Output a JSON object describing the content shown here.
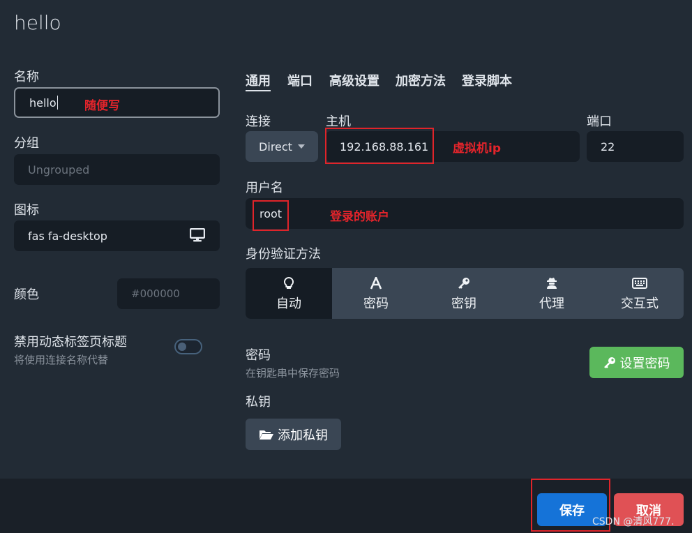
{
  "dialog": {
    "title": "hello"
  },
  "left": {
    "name_label": "名称",
    "name_value": "hello",
    "group_label": "分组",
    "group_placeholder": "Ungrouped",
    "icon_label": "图标",
    "icon_value": "fas fa-desktop",
    "color_label": "颜色",
    "color_placeholder": "#000000",
    "disable_title_label": "禁用动态标签页标题",
    "disable_title_sub": "将使用连接名称代替",
    "disable_title_on": false
  },
  "tabs": [
    "通用",
    "端口",
    "高级设置",
    "加密方法",
    "登录脚本"
  ],
  "connection": {
    "conn_label": "连接",
    "conn_value": "Direct",
    "host_label": "主机",
    "host_value": "192.168.88.161",
    "port_label": "端口",
    "port_value": "22",
    "user_label": "用户名",
    "user_value": "root",
    "auth_label": "身份验证方法",
    "auth_methods": [
      "自动",
      "密码",
      "密钥",
      "代理",
      "交互式"
    ],
    "auth_selected": "自动",
    "password_label": "密码",
    "password_sub": "在钥匙串中保存密码",
    "set_password_button": "设置密码",
    "private_key_label": "私钥",
    "add_key_button": "添加私钥"
  },
  "footer": {
    "save_button": "保存",
    "cancel_button": "取消",
    "watermark": "CSDN @清风777."
  },
  "annotations": {
    "name_note": "随便写",
    "host_note": "虚拟机ip",
    "user_note": "登录的账户"
  },
  "colors": {
    "background": "#222b35",
    "field": "#161d25",
    "save": "#1573d8",
    "cancel": "#e05155",
    "set_password": "#5bb85c",
    "annotation": "#e3242b"
  }
}
